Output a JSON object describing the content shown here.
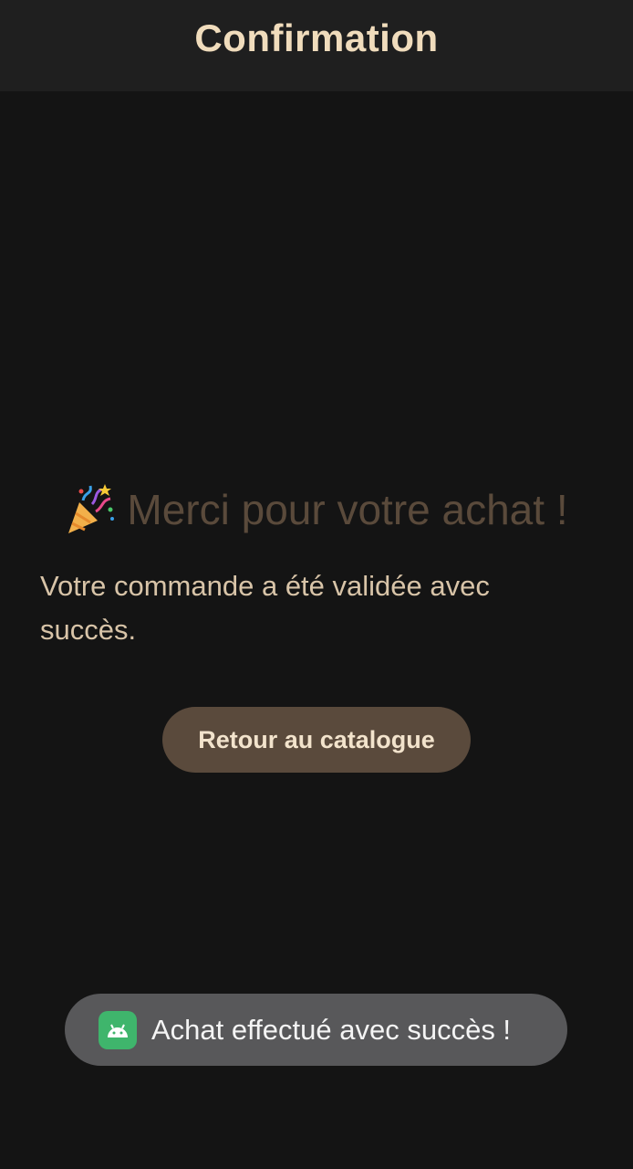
{
  "appbar": {
    "title": "Confirmation"
  },
  "main": {
    "headline_icon": "party-popper-icon",
    "headline": "Merci pour votre achat !",
    "message": "Votre commande a été validée avec succès.",
    "back_button_label": "Retour au catalogue"
  },
  "toast": {
    "icon": "android-icon",
    "text": "Achat effectué avec succès !"
  },
  "colors": {
    "background": "#141414",
    "appbar": "#1f1f1f",
    "title": "#f0dcbc",
    "headline": "#5a4a3b",
    "message": "#d8c4a8",
    "button": "#5a4a3c",
    "toast": "#58585a"
  }
}
